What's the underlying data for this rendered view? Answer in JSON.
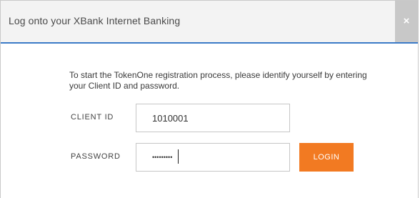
{
  "dialog": {
    "title": "Log onto your XBank Internet Banking",
    "close_label": "×"
  },
  "form": {
    "instruction": "To start the TokenOne registration process, please identify yourself by entering your Client ID and password.",
    "client_id": {
      "label": "CLIENT ID",
      "value": "1010001"
    },
    "password": {
      "label": "PASSWORD",
      "value": "•••••••••"
    },
    "login_label": "LOGIN"
  },
  "colors": {
    "header_bg": "#f3f3f3",
    "header_border": "#3b7ac7",
    "close_bg": "#c8c8c8",
    "login_bg": "#f27a22"
  }
}
